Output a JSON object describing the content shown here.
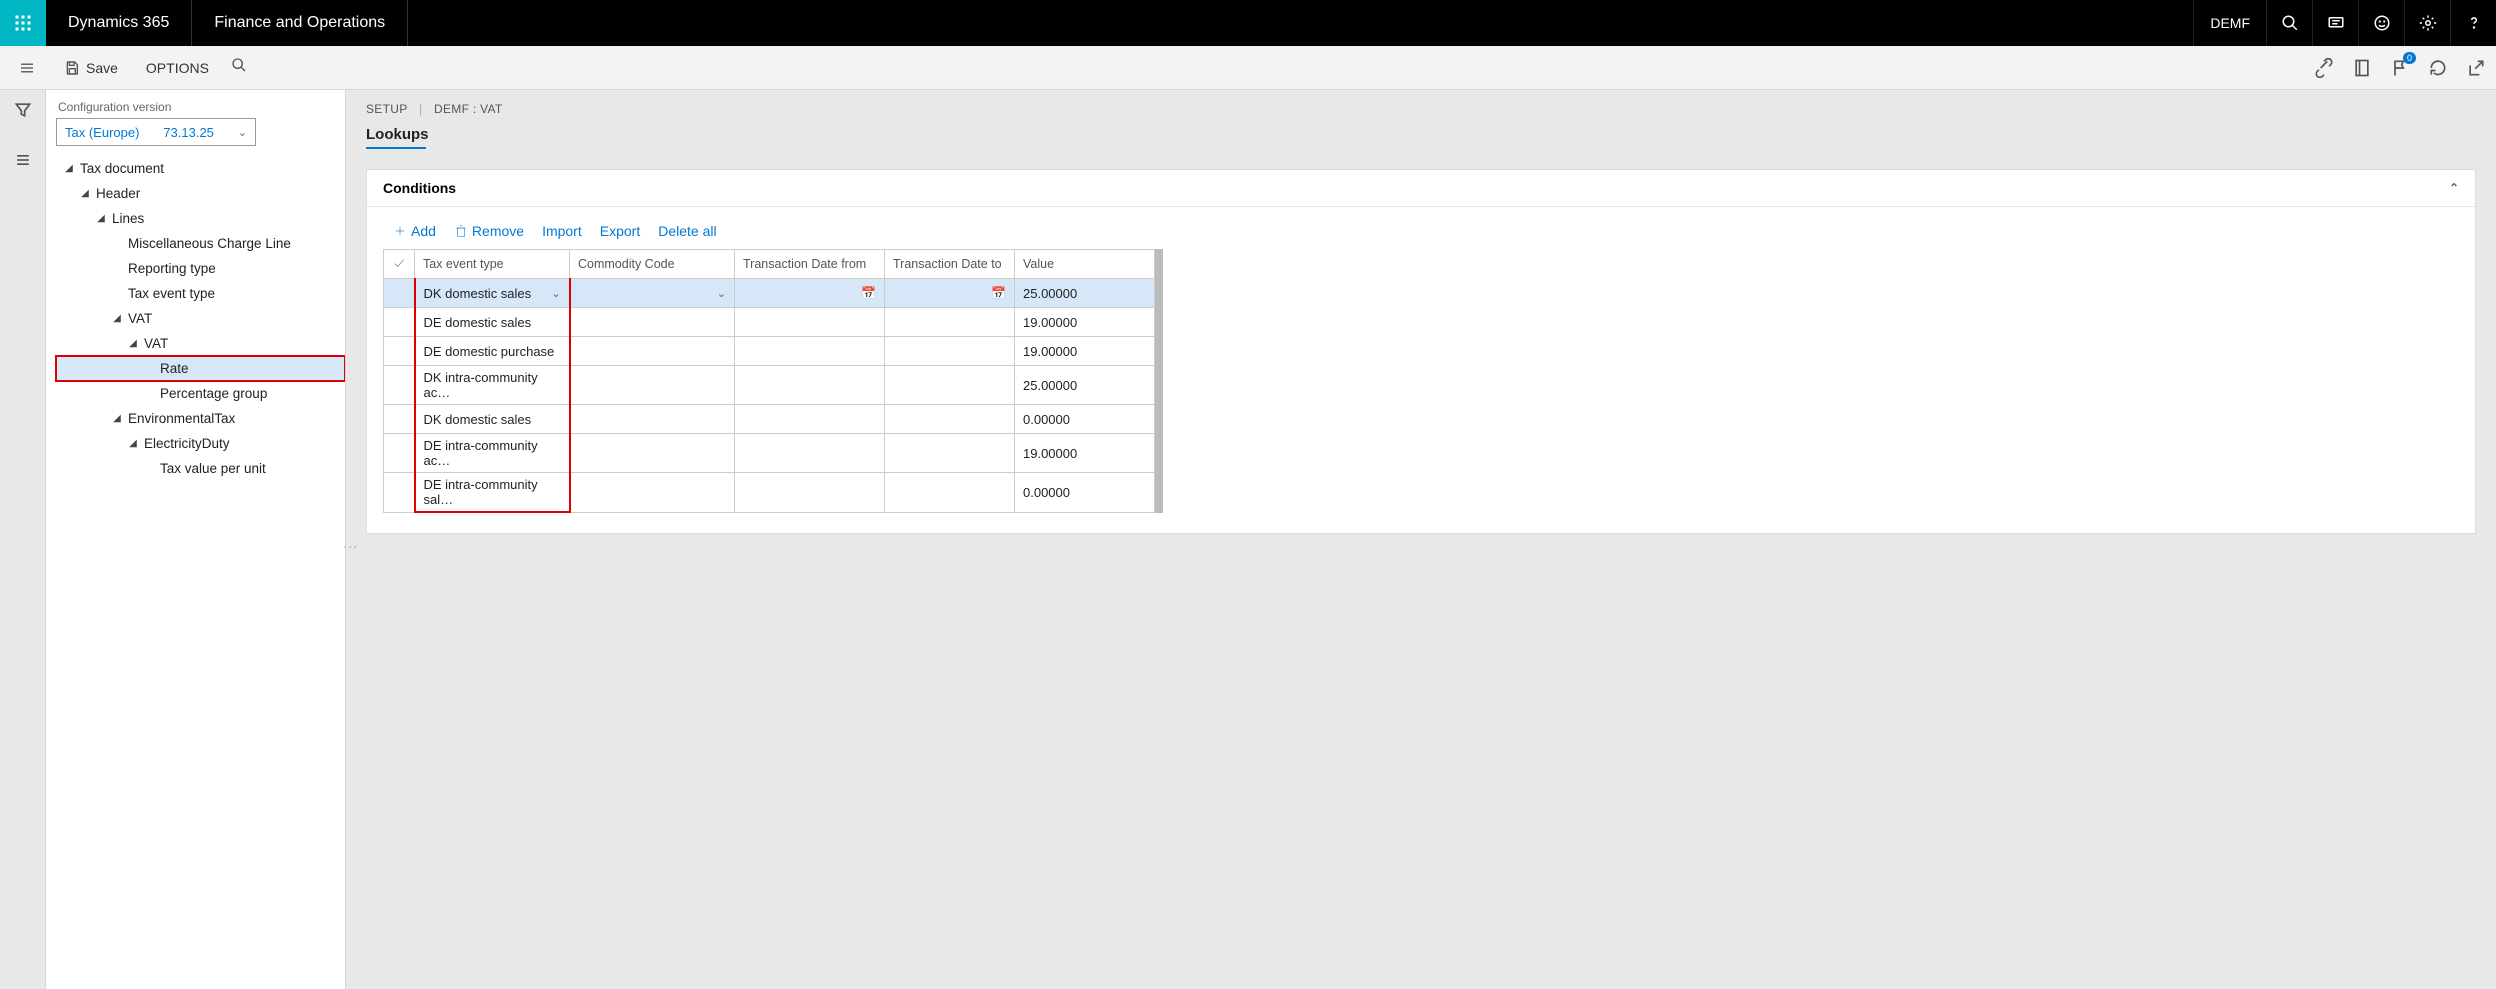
{
  "topbar": {
    "app1": "Dynamics 365",
    "app2": "Finance and Operations",
    "company": "DEMF"
  },
  "actionbar": {
    "save": "Save",
    "options": "OPTIONS"
  },
  "nav": {
    "cfg_label": "Configuration version",
    "cfg_name": "Tax (Europe)",
    "cfg_ver": "73.13.25",
    "tree": {
      "tax_document": "Tax document",
      "header": "Header",
      "lines": "Lines",
      "misc": "Miscellaneous Charge Line",
      "reporting_type": "Reporting type",
      "tax_event_type": "Tax event type",
      "vat": "VAT",
      "vat2": "VAT",
      "rate": "Rate",
      "pct_group": "Percentage group",
      "env_tax": "EnvironmentalTax",
      "elec_duty": "ElectricityDuty",
      "tax_val_unit": "Tax value per unit"
    }
  },
  "content": {
    "bc_setup": "SETUP",
    "bc_ctx": "DEMF : VAT",
    "page_title": "Lookups",
    "panel_title": "Conditions",
    "toolbar": {
      "add": "Add",
      "remove": "Remove",
      "import": "Import",
      "export": "Export",
      "delete_all": "Delete all"
    },
    "columns": {
      "evt": "Tax event type",
      "comm": "Commodity Code",
      "df": "Transaction Date from",
      "dt": "Transaction Date to",
      "val": "Value"
    },
    "rows": [
      {
        "evt": "DK domestic sales",
        "val": "25.00000",
        "selected": true
      },
      {
        "evt": "DE domestic sales",
        "val": "19.00000"
      },
      {
        "evt": "DE domestic purchase",
        "val": "19.00000"
      },
      {
        "evt": "DK intra-community ac…",
        "val": "25.00000"
      },
      {
        "evt": "DK domestic sales",
        "val": "0.00000"
      },
      {
        "evt": "DE intra-community ac…",
        "val": "19.00000"
      },
      {
        "evt": "DE intra-community sal…",
        "val": "0.00000"
      }
    ],
    "notif_badge": "0"
  }
}
